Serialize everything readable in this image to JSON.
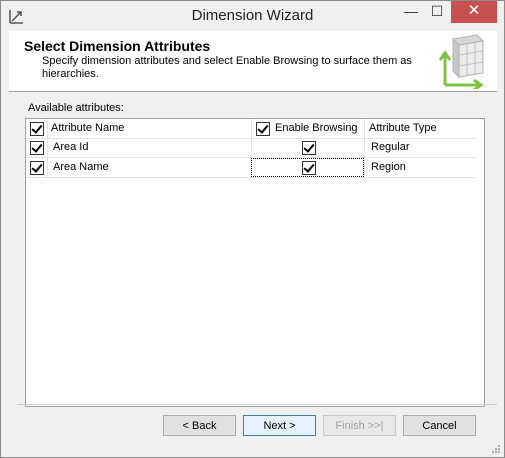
{
  "window": {
    "title": "Dimension Wizard",
    "controls": {
      "minimize": "—",
      "maximize": "☐",
      "close": "✕"
    }
  },
  "header": {
    "title": "Select Dimension Attributes",
    "description": "Specify dimension attributes and select Enable Browsing to surface them as hierarchies."
  },
  "main": {
    "available_label": "Available attributes:",
    "columns": {
      "attribute_name": "Attribute Name",
      "enable_browsing": "Enable Browsing",
      "attribute_type": "Attribute Type"
    },
    "rows": [
      {
        "selected": true,
        "name": "Area Id",
        "enable_browsing": true,
        "type": "Regular"
      },
      {
        "selected": true,
        "name": "Area Name",
        "enable_browsing": true,
        "type": "Region"
      }
    ]
  },
  "footer": {
    "back": "< Back",
    "next": "Next >",
    "finish": "Finish >>|",
    "cancel": "Cancel"
  },
  "colors": {
    "accent_green": "#7dc242",
    "close_red": "#c75050"
  }
}
